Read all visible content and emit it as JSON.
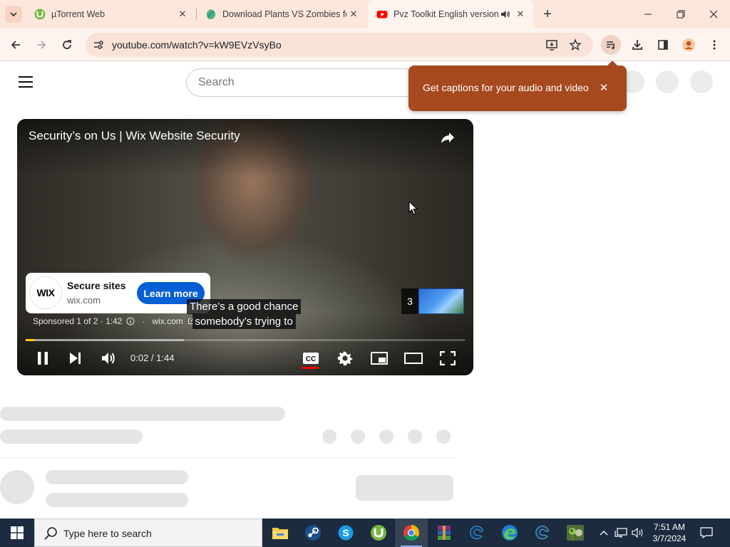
{
  "browser": {
    "tabs": [
      {
        "title": "µTorrent Web",
        "favicon": "utorrent-icon",
        "active": false
      },
      {
        "title": "Download Plants VS Zombies fo",
        "favicon": "edge-leaf-icon",
        "active": false
      },
      {
        "title": "Pvz Toolkit English version -",
        "favicon": "youtube-icon",
        "active": true,
        "audio": true
      }
    ],
    "url": "youtube.com/watch?v=kW9EVzVsyBo",
    "accent": "#fde7dd"
  },
  "youtube": {
    "search_placeholder": "Search",
    "caption_popup": {
      "text": "Get captions for your audio and video"
    },
    "player": {
      "title": "Security’s on Us | Wix Website Security",
      "ad": {
        "logo_text": "WIX",
        "title": "Secure sites",
        "domain": "wix.com",
        "cta": "Learn more",
        "sponsored": "Sponsored 1 of 2 · 1:42",
        "link": "wix.com"
      },
      "subtitles": [
        "There’s a good chance",
        "somebody’s trying to"
      ],
      "upnext_count": "3",
      "time": "0:02 / 1:44",
      "progress_fraction": 0.02,
      "buffer_fraction": 0.36,
      "progress_color": "#ffcc00"
    }
  },
  "taskbar": {
    "search_placeholder": "Type here to search",
    "apps": [
      "file-explorer-icon",
      "steam-icon",
      "skype-icon",
      "utorrent-icon",
      "chrome-icon",
      "winrar-icon",
      "edge-dev-icon",
      "edge-icon",
      "edge-canary-icon",
      "plants-vs-zombies-icon"
    ],
    "time": "7:51 AM",
    "date": "3/7/2024"
  }
}
